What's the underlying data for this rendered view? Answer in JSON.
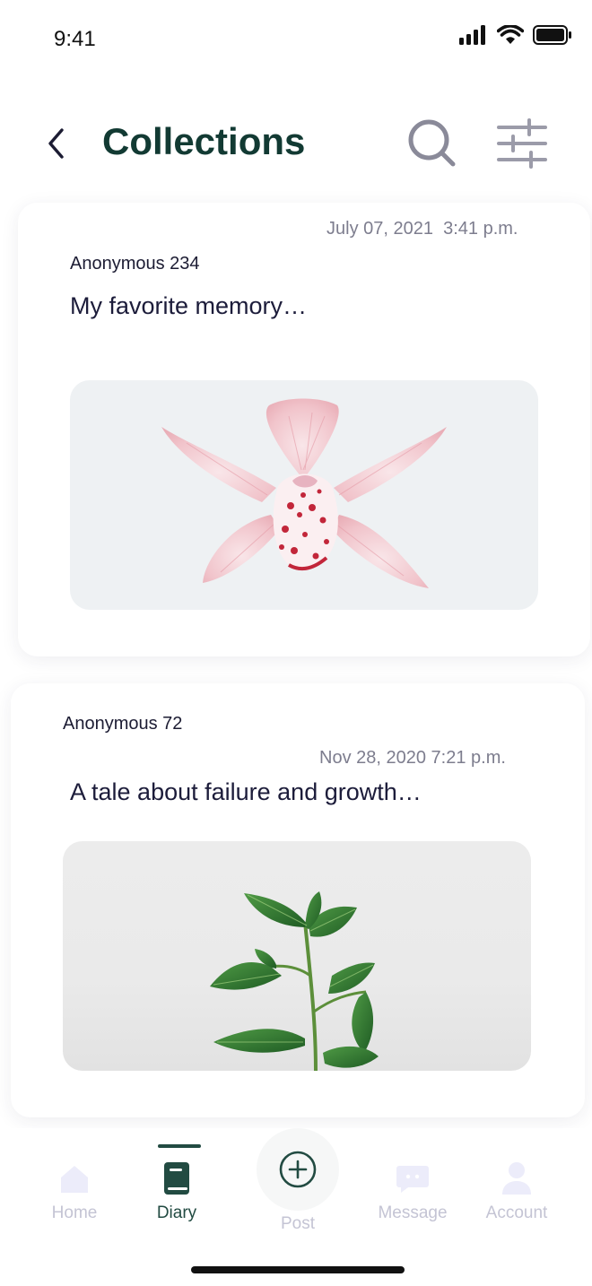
{
  "status_bar": {
    "time": "9:41"
  },
  "header": {
    "title": "Collections"
  },
  "posts": [
    {
      "author": "Anonymous 234",
      "date": "July 07, 2021",
      "time": "3:41 p.m.",
      "excerpt": "My favorite memory…",
      "image_subject": "pink orchid"
    },
    {
      "author": "Anonymous 72",
      "date": "Nov 28, 2020",
      "time": "7:21 p.m.",
      "excerpt": "A tale about failure and growth…",
      "image_subject": "green plant"
    }
  ],
  "tabbar": {
    "items": [
      {
        "label": "Home",
        "icon": "home-icon",
        "active": false
      },
      {
        "label": "Diary",
        "icon": "book-icon",
        "active": true
      },
      {
        "label": "Post",
        "icon": "plus-circle-icon",
        "active": false
      },
      {
        "label": "Message",
        "icon": "message-icon",
        "active": false
      },
      {
        "label": "Account",
        "icon": "user-icon",
        "active": false
      }
    ]
  },
  "colors": {
    "title": "#123a33",
    "accent": "#224b42",
    "inactive_tab": "#c4c4d4",
    "meta_text": "#7d7d8e"
  }
}
